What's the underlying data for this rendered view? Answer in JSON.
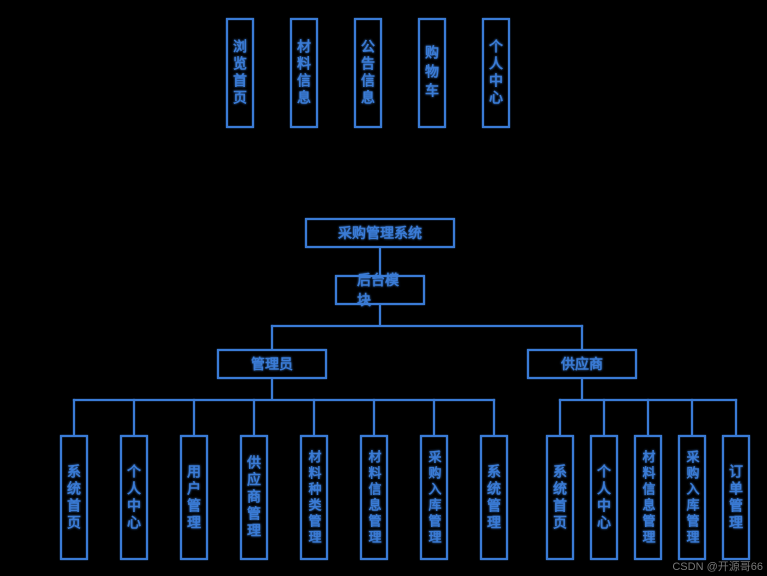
{
  "top_nav": [
    "浏览首页",
    "材料信息",
    "公告信息",
    "购物车",
    "个人中心"
  ],
  "root": "采购管理系统",
  "mid": "后台模块",
  "roles": {
    "admin": "管理员",
    "supplier": "供应商"
  },
  "admin_items": [
    "系统首页",
    "个人中心",
    "用户管理",
    "供应商管理",
    "材料种类管理",
    "材料信息管理",
    "采购入库管理",
    "系统管理"
  ],
  "supplier_items": [
    "系统首页",
    "个人中心",
    "材料信息管理",
    "采购入库管理",
    "订单管理"
  ],
  "watermark": "CSDN @开源哥66"
}
